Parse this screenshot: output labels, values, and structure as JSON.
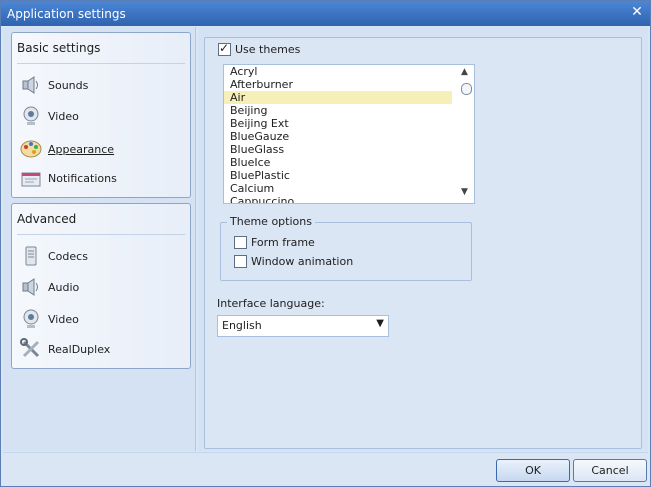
{
  "window": {
    "title": "Application settings"
  },
  "nav": {
    "basic": {
      "heading": "Basic settings",
      "items": [
        {
          "label": "Sounds",
          "icon": "speaker-icon"
        },
        {
          "label": "Video",
          "icon": "webcam-icon"
        },
        {
          "label": "Appearance",
          "icon": "palette-icon",
          "active": true
        },
        {
          "label": "Notifications",
          "icon": "notification-icon"
        }
      ]
    },
    "advanced": {
      "heading": "Advanced",
      "items": [
        {
          "label": "Codecs",
          "icon": "codec-icon"
        },
        {
          "label": "Audio",
          "icon": "speaker-icon"
        },
        {
          "label": "Video",
          "icon": "webcam-icon"
        },
        {
          "label": "RealDuplex",
          "icon": "tools-icon"
        }
      ]
    }
  },
  "appearance": {
    "use_themes_label": "Use themes",
    "use_themes_checked": true,
    "themes": [
      "Acryl",
      "Afterburner",
      "Air",
      "Beijing",
      "Beijing Ext",
      "BlueGauze",
      "BlueGlass",
      "BlueIce",
      "BluePlastic",
      "Calcium",
      "Cappuccino"
    ],
    "selected_theme": "Air",
    "theme_options": {
      "legend": "Theme options",
      "form_frame_label": "Form frame",
      "form_frame_checked": false,
      "window_animation_label": "Window animation",
      "window_animation_checked": false
    },
    "language_label": "Interface language:",
    "language_value": "English"
  },
  "buttons": {
    "ok": "OK",
    "cancel": "Cancel"
  },
  "colors": {
    "titlebar": "#3a70c0",
    "selection": "#f6efb8",
    "accent": "#5b7fb4"
  }
}
